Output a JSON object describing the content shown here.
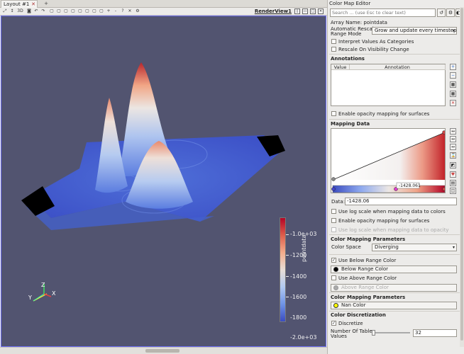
{
  "layout_tab": {
    "label": "Layout #1",
    "close": "✕",
    "add": "+"
  },
  "toolbar": {
    "view_title": "RenderView1"
  },
  "scalar_bar": {
    "title": "pointdata",
    "labels": [
      "-1.0e+03",
      "-1200",
      "-1400",
      "-1600",
      "-1800",
      "-2.0e+03"
    ]
  },
  "axes": {
    "x": "X",
    "y": "Y",
    "z": "Z"
  },
  "panel": {
    "title": "Color Map Editor",
    "search_placeholder": "Search ... (use Esc to clear text)",
    "array_name": "Array Name: pointdata",
    "auto_rescale_label": "Automatic Rescale\nRange Mode",
    "auto_rescale_line1": "Automatic Rescale",
    "auto_rescale_line2": "Range Mode",
    "auto_rescale_value": "Grow and update every timestep",
    "interpret_categories": "Interpret Values As Categories",
    "rescale_visibility": "Rescale On Visibility Change",
    "annotations_header": "Annotations",
    "col_value": "Value",
    "col_annotation": "Annotation",
    "opacity_surfaces_1": "Enable opacity mapping for surfaces",
    "mapping_header": "Mapping Data",
    "marker_value": "-1428.061",
    "data_label": "Data:",
    "data_value": "-1428.06",
    "log_scale": "Use log scale when mapping data to colors",
    "opacity_surfaces_2": "Enable opacity mapping for surfaces",
    "log_opacity": "Use log scale when mapping data to opacity",
    "cmp_header_1": "Color Mapping Parameters",
    "color_space_label": "Color Space",
    "color_space_value": "Diverging",
    "below_range_toggle": "Use Below Range Color",
    "below_range_button": "Below Range Color",
    "above_range_toggle": "Use Above Range Color",
    "above_range_button": "Above Range Color",
    "cmp_header_2": "Color Mapping Parameters",
    "nan_color": "Nan Color",
    "discretization_header": "Color Discretization",
    "discretize": "Discretize",
    "table_values_line1": "Number Of Table",
    "table_values_line2": "Values",
    "table_values": "32"
  },
  "colors": {
    "accent": "#6a6cf0",
    "background": "#525470",
    "below_range": "#000000",
    "nan": "#ffff00",
    "above_range": "#aaaaaa"
  }
}
